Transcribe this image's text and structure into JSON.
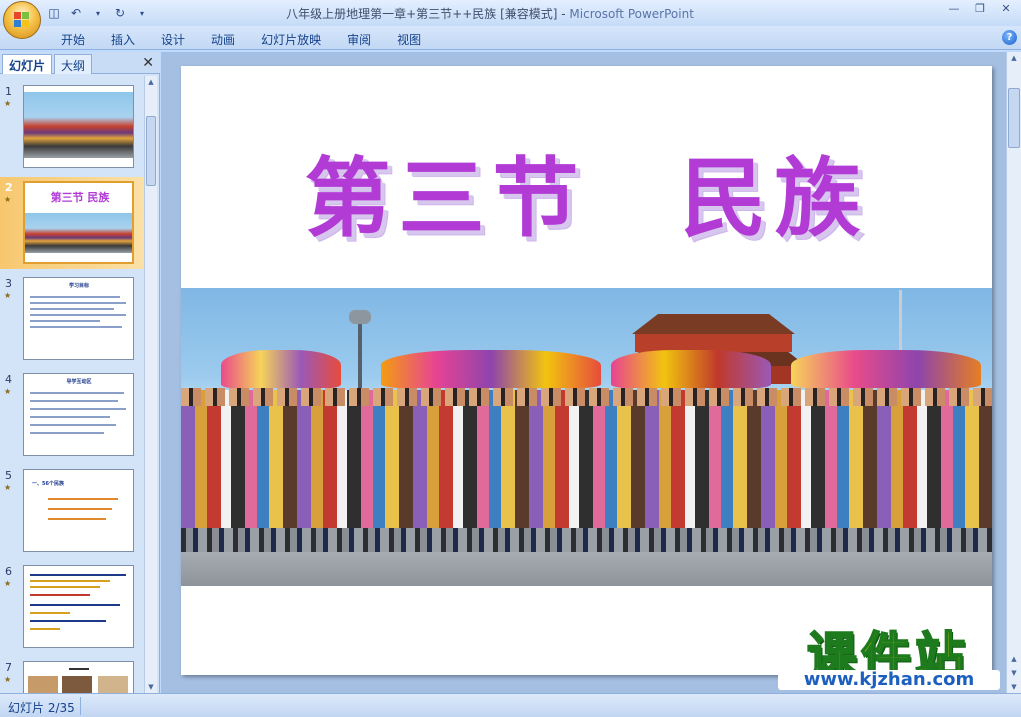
{
  "window": {
    "title": "八年级上册地理第一章+第三节++民族 [兼容模式]",
    "separator": " - ",
    "app_name": "Microsoft PowerPoint"
  },
  "quick_access": [
    {
      "icon": "save-icon"
    },
    {
      "icon": "undo-icon"
    },
    {
      "icon": "redo-icon"
    },
    {
      "icon": "customize-dropdown-icon"
    }
  ],
  "ribbon": {
    "tabs": [
      "开始",
      "插入",
      "设计",
      "动画",
      "幻灯片放映",
      "审阅",
      "视图"
    ]
  },
  "panel": {
    "tabs": [
      "幻灯片",
      "大纲"
    ],
    "active_tab": "幻灯片"
  },
  "thumbnails": [
    {
      "num": "1",
      "kind": "photo"
    },
    {
      "num": "2",
      "kind": "title-photo",
      "mini_title": "第三节   民族",
      "selected": true
    },
    {
      "num": "3",
      "kind": "text",
      "mini_title": "学习目标"
    },
    {
      "num": "4",
      "kind": "text",
      "mini_title": "导学互动区"
    },
    {
      "num": "5",
      "kind": "text",
      "mini_title": "一、56个民族"
    },
    {
      "num": "6",
      "kind": "text",
      "mini_title": ""
    },
    {
      "num": "7",
      "kind": "partial",
      "mini_title": ""
    }
  ],
  "slide": {
    "title": "第三节　民族"
  },
  "watermark": {
    "brand": "课件站",
    "url": "www.kjzhan.com"
  },
  "status": {
    "slide_count": "幻灯片 2/35"
  },
  "colors": {
    "title_purple": "#b23bd6",
    "ribbon_blue": "#c2d8f4",
    "selection_orange": "#f7c76e",
    "watermark_yellow": "#f3e000",
    "watermark_green": "#1d7a1d"
  }
}
